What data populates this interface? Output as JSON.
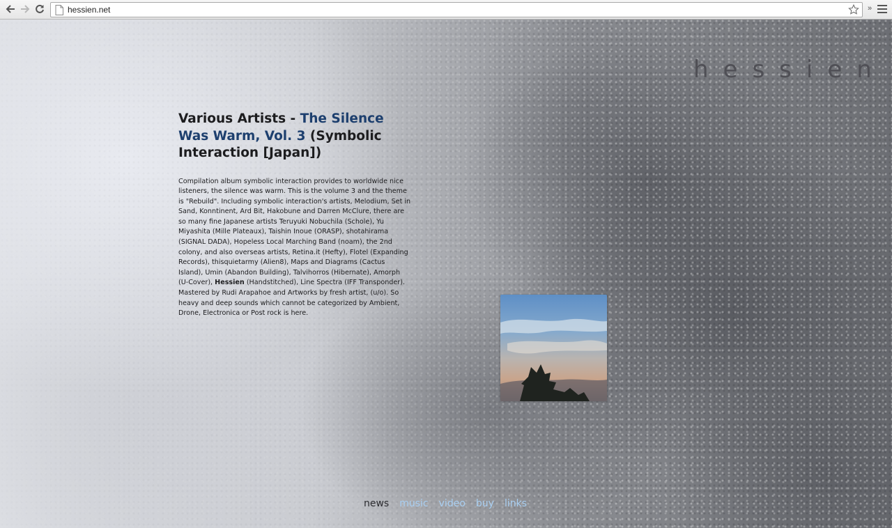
{
  "browser": {
    "url": "hessien.net",
    "back_icon": "back-arrow-icon",
    "forward_icon": "forward-arrow-icon",
    "reload_icon": "reload-icon",
    "bookmark_icon": "star-icon",
    "extensions_label": "»",
    "menu_icon": "hamburger-menu-icon"
  },
  "site": {
    "logo": "hessien"
  },
  "article": {
    "title_prefix": "Various Artists - ",
    "album_title": "The Silence Was Warm, Vol. 3",
    "label_suffix": " (Symbolic Interaction [Japan])",
    "body_part1": "Compilation album symbolic interaction provides to worldwide nice listeners, the silence was warm. This is the volume 3 and the theme is \"Rebuild\". Including symbolic interaction's artists, Melodium, Set in Sand, Konntinent, Ard Bit, Hakobune and Darren McClure, there are so many fine Japanese artists Teruyuki Nobuchila (Schole), Yu Miyashita (Mille Plateaux), Taishin Inoue (ORASP), shotahirama (SIGNAL DADA), Hopeless Local Marching Band (noam), the 2nd colony, and also overseas artists, Retina.it (Hefty), Flotel (Expanding Records), thisquietarmy (Alien8), Maps and Diagrams (Cactus Island), Umin (Abandon Building), Talvihorros (Hibernate), Amorph (U-Cover), ",
    "body_bold": "Hessien",
    "body_part2": " (Handstitched), Line Spectra (IFF Transponder). Mastered by Rudi Arapahoe and Artworks by fresh artist, (u/o). So heavy and deep sounds which cannot be categorized by Ambient, Drone, Electronica or Post rock is here."
  },
  "nav": {
    "items": [
      {
        "label": "news",
        "active": true
      },
      {
        "label": "music",
        "active": false
      },
      {
        "label": "video",
        "active": false
      },
      {
        "label": "buy",
        "active": false
      },
      {
        "label": "links",
        "active": false
      }
    ]
  },
  "colors": {
    "album_link": "#1d3f6e",
    "nav_link": "#a9cff2",
    "nav_active": "#2b2b2f",
    "logo": "#4f4f55"
  }
}
